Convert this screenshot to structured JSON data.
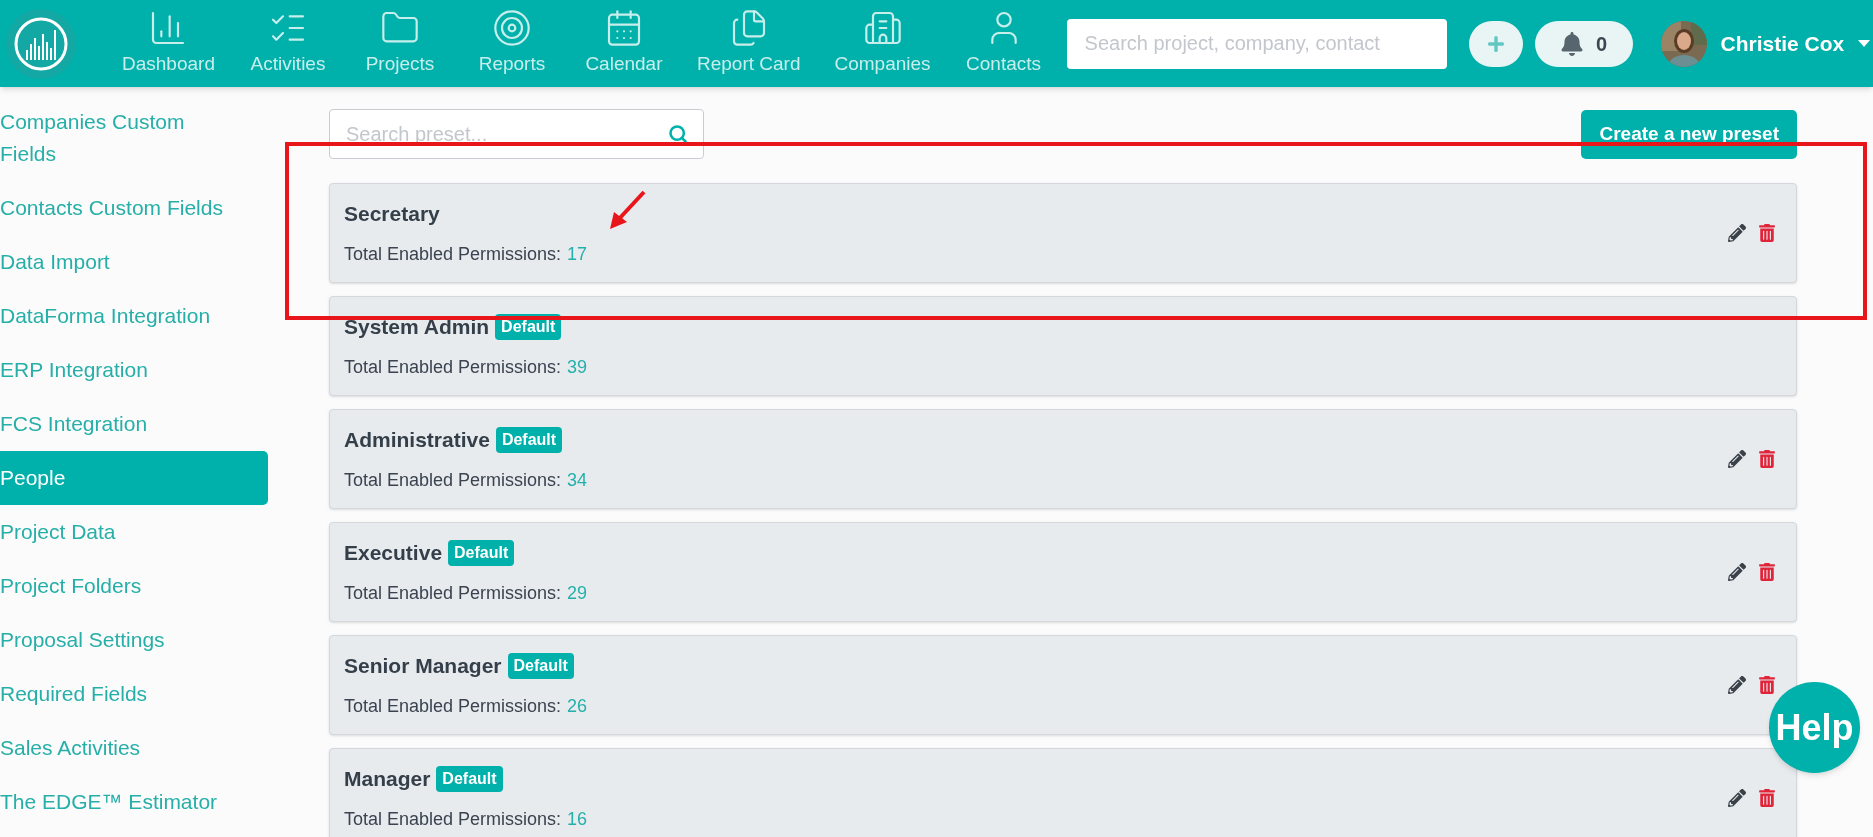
{
  "navbar": {
    "items": [
      {
        "label": "Dashboard"
      },
      {
        "label": "Activities"
      },
      {
        "label": "Projects"
      },
      {
        "label": "Reports"
      },
      {
        "label": "Calendar"
      },
      {
        "label": "Report Card"
      },
      {
        "label": "Companies"
      },
      {
        "label": "Contacts"
      }
    ],
    "search": {
      "placeholder": "Search project, company, contact"
    },
    "notifications": "0",
    "user": {
      "name": "Christie Cox"
    }
  },
  "sidebar": {
    "items": [
      {
        "label": "Companies Custom Fields",
        "selected": false
      },
      {
        "label": "Contacts Custom Fields",
        "selected": false
      },
      {
        "label": "Data Import",
        "selected": false
      },
      {
        "label": "DataForma Integration",
        "selected": false
      },
      {
        "label": "ERP Integration",
        "selected": false
      },
      {
        "label": "FCS Integration",
        "selected": false
      },
      {
        "label": "People",
        "selected": true
      },
      {
        "label": "Project Data",
        "selected": false
      },
      {
        "label": "Project Folders",
        "selected": false
      },
      {
        "label": "Proposal Settings",
        "selected": false
      },
      {
        "label": "Required Fields",
        "selected": false
      },
      {
        "label": "Sales Activities",
        "selected": false
      },
      {
        "label": "The EDGE™ Estimator",
        "selected": false
      }
    ]
  },
  "preset_search": {
    "placeholder": "Search preset..."
  },
  "create_button": "Create a new preset",
  "presets": [
    {
      "name": "Secretary",
      "label": "Total Enabled Permissions:",
      "count": "17",
      "actions": true
    },
    {
      "name": "System Admin",
      "badge": "Default",
      "label": "Total Enabled Permissions:",
      "count": "39",
      "actions": false
    },
    {
      "name": "Administrative",
      "badge": "Default",
      "label": "Total Enabled Permissions:",
      "count": "34",
      "actions": true
    },
    {
      "name": "Executive",
      "badge": "Default",
      "label": "Total Enabled Permissions:",
      "count": "29",
      "actions": true
    },
    {
      "name": "Senior Manager",
      "badge": "Default",
      "label": "Total Enabled Permissions:",
      "count": "26",
      "actions": true
    },
    {
      "name": "Manager",
      "badge": "Default",
      "label": "Total Enabled Permissions:",
      "count": "16",
      "actions": true
    }
  ],
  "help_button": "Help"
}
